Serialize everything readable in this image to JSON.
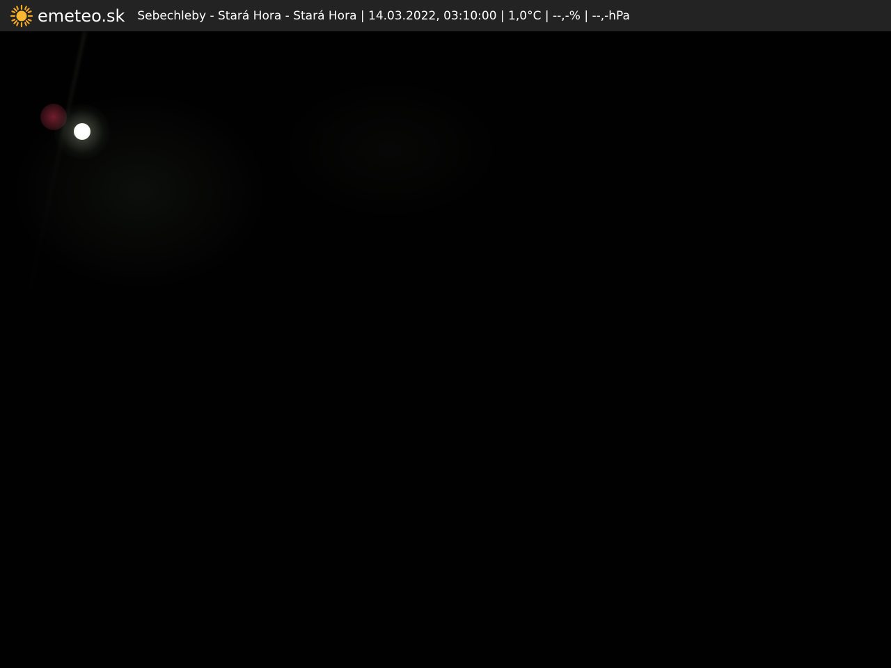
{
  "header": {
    "brand": "emeteo.sk",
    "logo_icon": "sun-icon",
    "caption": "Sebechleby - Stará Hora - Stará Hora | 14.03.2022, 03:10:00 | 1,0°C | --,-% | --,-hPa"
  },
  "colors": {
    "bar_background": "#232323",
    "text": "#ffffff",
    "sun": "#f5a623",
    "scene_background": "#010101"
  }
}
